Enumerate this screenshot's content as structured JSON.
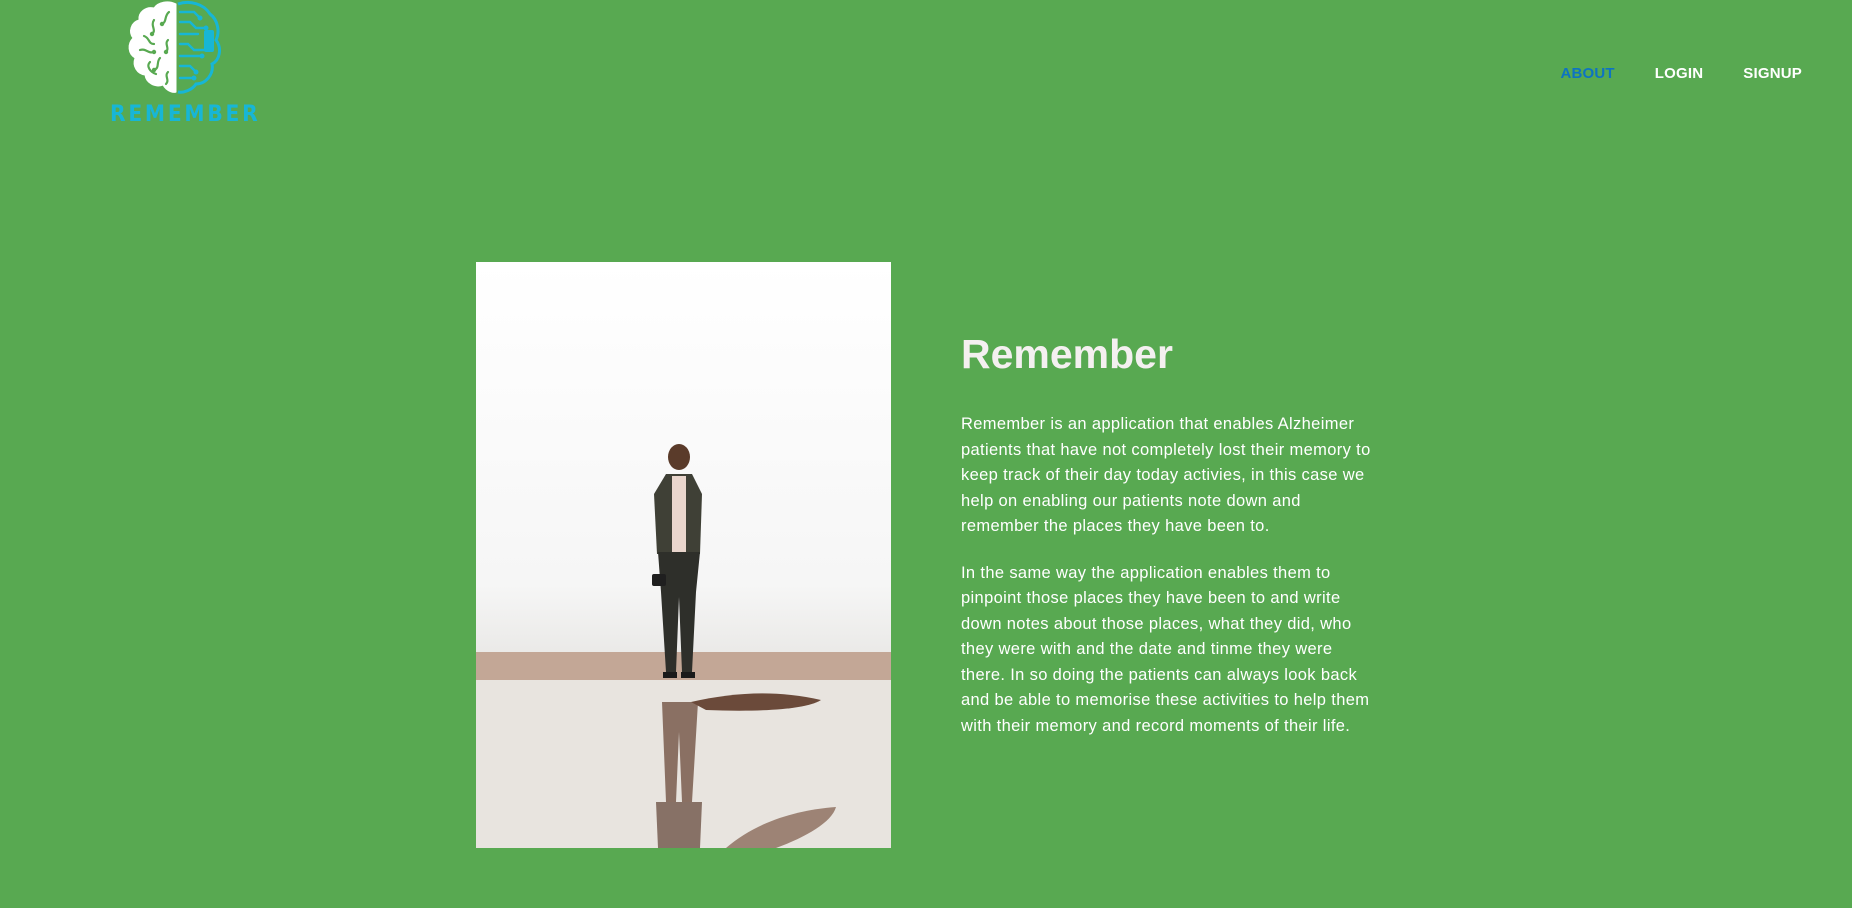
{
  "header": {
    "logo_text": "REMEMBER",
    "nav": [
      {
        "label": "ABOUT",
        "active": true
      },
      {
        "label": "LOGIN",
        "active": false
      },
      {
        "label": "SIGNUP",
        "active": false
      }
    ]
  },
  "main": {
    "title": "Remember",
    "paragraphs": [
      "Remember is an application that enables Alzheimer patients that have not completely lost their memory to keep track of their day today activies, in this case we help on enabling our patients note down and remember the places they have been to.",
      "In the same way the application enables them to pinpoint those places they have been to and write down notes about those places, what they did, who they were with and the date and tinme they were there. In so doing the patients can always look back and be able to memorise these activities to help them with their memory and record moments of their life."
    ]
  },
  "colors": {
    "background": "#58a951",
    "nav_active": "#0d73c2",
    "logo": "#17b6d6"
  }
}
